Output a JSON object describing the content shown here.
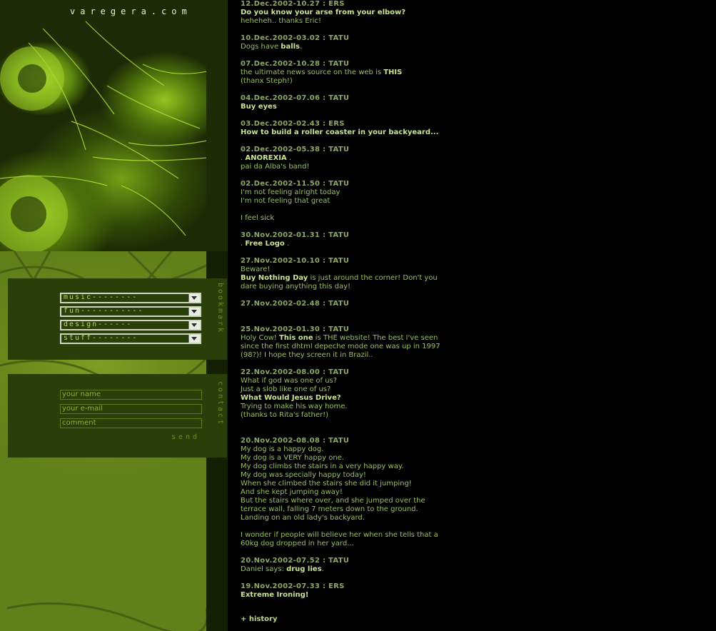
{
  "site": {
    "logo": "varegera.com"
  },
  "bookmark": {
    "label": "bookmark",
    "menus": [
      {
        "label": "music--------"
      },
      {
        "label": "fun-----------"
      },
      {
        "label": "design------"
      },
      {
        "label": "stuff--------"
      }
    ]
  },
  "contact": {
    "label": "contact",
    "name_placeholder": "your name",
    "email_placeholder": "your e-mail",
    "comment_placeholder": "comment",
    "send": "send"
  },
  "news": [
    {
      "date": "12.Dec.2002-10.27 : ERS",
      "lines": [
        {
          "parts": [
            {
              "t": "Do you know your arse from your elbow?",
              "link": true
            }
          ]
        },
        {
          "parts": [
            {
              "t": "heheheh.. thanks Eric!"
            }
          ]
        }
      ]
    },
    {
      "date": "10.Dec.2002-03.02 : TATU",
      "lines": [
        {
          "parts": [
            {
              "t": "Dogs have "
            },
            {
              "t": "balls",
              "link": true
            },
            {
              "t": "."
            }
          ]
        }
      ]
    },
    {
      "date": "07.Dec.2002-10.28 : TATU",
      "lines": [
        {
          "parts": [
            {
              "t": "the ultimate news source on the web is "
            },
            {
              "t": "THIS",
              "link": true
            }
          ]
        },
        {
          "parts": [
            {
              "t": "(thanx Steph!)"
            }
          ]
        }
      ]
    },
    {
      "date": "04.Dec.2002-07.06 : TATU",
      "lines": [
        {
          "parts": [
            {
              "t": "Buy eyes",
              "link": true
            }
          ]
        }
      ]
    },
    {
      "date": "03.Dec.2002-02.43 : ERS",
      "lines": [
        {
          "parts": [
            {
              "t": "How to build a roller coaster in your backyeard...",
              "link": true
            }
          ]
        }
      ]
    },
    {
      "date": "02.Dec.2002-05.38 : TATU",
      "lines": [
        {
          "parts": [
            {
              "t": ". "
            },
            {
              "t": "ANOREXIA",
              "link": true
            },
            {
              "t": " ."
            }
          ]
        },
        {
          "parts": [
            {
              "t": "pai da Alba's band!"
            }
          ]
        }
      ]
    },
    {
      "date": "02.Dec.2002-11.50 : TATU",
      "lines": [
        {
          "parts": [
            {
              "t": "I'm not feeling alright today"
            }
          ]
        },
        {
          "parts": [
            {
              "t": "I'm not feeling that great"
            }
          ]
        },
        {
          "parts": [
            {
              "t": ""
            }
          ]
        },
        {
          "parts": [
            {
              "t": "I feel sick"
            }
          ]
        }
      ]
    },
    {
      "date": "30.Nov.2002-01.31 : TATU",
      "lines": [
        {
          "parts": [
            {
              "t": ". "
            },
            {
              "t": "Free Logo",
              "link": true
            },
            {
              "t": " ."
            }
          ]
        }
      ]
    },
    {
      "date": "27.Nov.2002-10.10 : TATU",
      "lines": [
        {
          "parts": [
            {
              "t": "Beware!"
            }
          ]
        },
        {
          "parts": [
            {
              "t": "Buy Nothing Day",
              "link": true
            },
            {
              "t": " is just around the corner! Don't you"
            }
          ]
        },
        {
          "parts": [
            {
              "t": "dare buying anything this day!"
            }
          ]
        }
      ]
    },
    {
      "date": "27.Nov.2002-02.48 : TATU",
      "lines": []
    },
    {
      "date": "25.Nov.2002-01.30 : TATU",
      "lines": [
        {
          "parts": [
            {
              "t": "Holy Cow! "
            },
            {
              "t": "This one",
              "link": true
            },
            {
              "t": " is THE website! The best I've seen"
            }
          ]
        },
        {
          "parts": [
            {
              "t": "since the first dhtml depeche mode one was up in 1997"
            }
          ]
        },
        {
          "parts": [
            {
              "t": "(98?)! I hope they screen it in Brazil.."
            }
          ]
        }
      ]
    },
    {
      "date": "22.Nov.2002-08.00 : TATU",
      "lines": [
        {
          "parts": [
            {
              "t": "What if god was one of us?"
            }
          ]
        },
        {
          "parts": [
            {
              "t": "Just a slob like one of us?"
            }
          ]
        },
        {
          "parts": [
            {
              "t": "What Would Jesus Drive?",
              "link": true
            }
          ]
        },
        {
          "parts": [
            {
              "t": "Trying to make his way home."
            }
          ]
        },
        {
          "parts": [
            {
              "t": "(thanks to Rita's father!)"
            }
          ]
        }
      ]
    },
    {
      "date": "20.Nov.2002-08.08 : TATU",
      "lines": [
        {
          "parts": [
            {
              "t": "My dog is a happy dog."
            }
          ]
        },
        {
          "parts": [
            {
              "t": "My dog is a VERY happy one."
            }
          ]
        },
        {
          "parts": [
            {
              "t": "My dog climbs the stairs in a very happy way."
            }
          ]
        },
        {
          "parts": [
            {
              "t": "My dog was specially happy today!"
            }
          ]
        },
        {
          "parts": [
            {
              "t": "When she climbed the stairs she did it jumping!"
            }
          ]
        },
        {
          "parts": [
            {
              "t": "And she kept jumping away!"
            }
          ]
        },
        {
          "parts": [
            {
              "t": "But the stairs where over, and she jumped over the"
            }
          ]
        },
        {
          "parts": [
            {
              "t": "terrace wall, falling 7 meters down to the ground."
            }
          ]
        },
        {
          "parts": [
            {
              "t": "Landing on an old lady's backyard."
            }
          ]
        },
        {
          "parts": [
            {
              "t": ""
            }
          ]
        },
        {
          "parts": [
            {
              "t": "I wonder if people will believe her when she tells that a"
            }
          ]
        },
        {
          "parts": [
            {
              "t": "60kg dog dropped in her yard..."
            }
          ]
        }
      ]
    },
    {
      "date": "20.Nov.2002-07.52 : TATU",
      "lines": [
        {
          "parts": [
            {
              "t": "Daniel says: "
            },
            {
              "t": "drug lies",
              "link": true
            },
            {
              "t": "."
            }
          ]
        }
      ]
    },
    {
      "date": "19.Nov.2002-07.33 : ERS",
      "lines": [
        {
          "parts": [
            {
              "t": "Extreme Ironing!",
              "link": true
            }
          ]
        }
      ]
    }
  ],
  "history": "+ history"
}
